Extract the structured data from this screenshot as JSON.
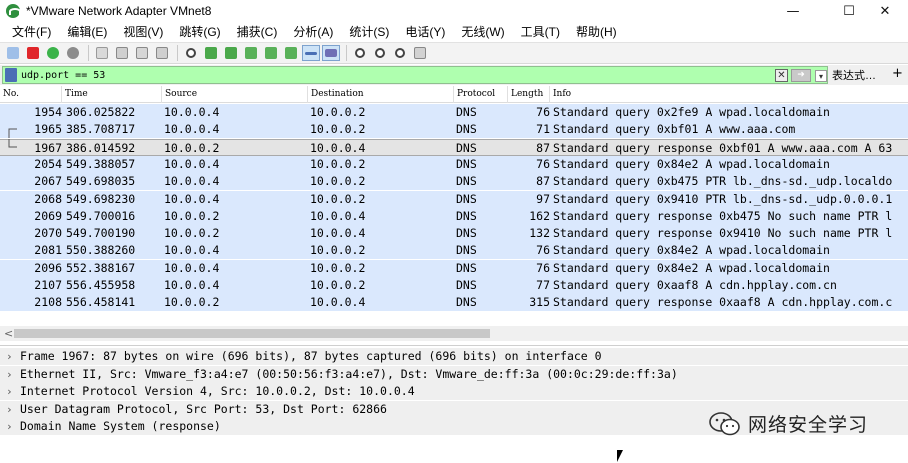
{
  "window": {
    "title": "*VMware Network Adapter VMnet8",
    "minimize": "—",
    "maximize": "☐",
    "close": "✕"
  },
  "menu": [
    "文件(F)",
    "编辑(E)",
    "视图(V)",
    "跳转(G)",
    "捕获(C)",
    "分析(A)",
    "统计(S)",
    "电话(Y)",
    "无线(W)",
    "工具(T)",
    "帮助(H)"
  ],
  "filter": {
    "value": "udp.port == 53",
    "expression_label": "表达式…",
    "add_label": "+"
  },
  "columns": [
    "No.",
    "Time",
    "Source",
    "Destination",
    "Protocol",
    "Length",
    "Info"
  ],
  "packets": [
    {
      "no": "1954",
      "time": "306.025822",
      "src": "10.0.0.4",
      "dst": "10.0.0.2",
      "proto": "DNS",
      "len": "76",
      "info": "Standard query 0x2fe9 A wpad.localdomain"
    },
    {
      "no": "1965",
      "time": "385.708717",
      "src": "10.0.0.4",
      "dst": "10.0.0.2",
      "proto": "DNS",
      "len": "71",
      "info": "Standard query 0xbf01 A www.aaa.com"
    },
    {
      "no": "1967",
      "time": "386.014592",
      "src": "10.0.0.2",
      "dst": "10.0.0.4",
      "proto": "DNS",
      "len": "87",
      "info": "Standard query response 0xbf01 A www.aaa.com A 63"
    },
    {
      "no": "2054",
      "time": "549.388057",
      "src": "10.0.0.4",
      "dst": "10.0.0.2",
      "proto": "DNS",
      "len": "76",
      "info": "Standard query 0x84e2 A wpad.localdomain"
    },
    {
      "no": "2067",
      "time": "549.698035",
      "src": "10.0.0.4",
      "dst": "10.0.0.2",
      "proto": "DNS",
      "len": "87",
      "info": "Standard query 0xb475 PTR lb._dns-sd._udp.localdo"
    },
    {
      "no": "2068",
      "time": "549.698230",
      "src": "10.0.0.4",
      "dst": "10.0.0.2",
      "proto": "DNS",
      "len": "97",
      "info": "Standard query 0x9410 PTR lb._dns-sd._udp.0.0.0.1"
    },
    {
      "no": "2069",
      "time": "549.700016",
      "src": "10.0.0.2",
      "dst": "10.0.0.4",
      "proto": "DNS",
      "len": "162",
      "info": "Standard query response 0xb475 No such name PTR l"
    },
    {
      "no": "2070",
      "time": "549.700190",
      "src": "10.0.0.2",
      "dst": "10.0.0.4",
      "proto": "DNS",
      "len": "132",
      "info": "Standard query response 0x9410 No such name PTR l"
    },
    {
      "no": "2081",
      "time": "550.388260",
      "src": "10.0.0.4",
      "dst": "10.0.0.2",
      "proto": "DNS",
      "len": "76",
      "info": "Standard query 0x84e2 A wpad.localdomain"
    },
    {
      "no": "2096",
      "time": "552.388167",
      "src": "10.0.0.4",
      "dst": "10.0.0.2",
      "proto": "DNS",
      "len": "76",
      "info": "Standard query 0x84e2 A wpad.localdomain"
    },
    {
      "no": "2107",
      "time": "556.455958",
      "src": "10.0.0.4",
      "dst": "10.0.0.2",
      "proto": "DNS",
      "len": "77",
      "info": "Standard query 0xaaf8 A cdn.hpplay.com.cn"
    },
    {
      "no": "2108",
      "time": "556.458141",
      "src": "10.0.0.2",
      "dst": "10.0.0.4",
      "proto": "DNS",
      "len": "315",
      "info": "Standard query response 0xaaf8 A cdn.hpplay.com.c"
    }
  ],
  "selected_packet": "1967",
  "details": [
    "Frame 1967: 87 bytes on wire (696 bits), 87 bytes captured (696 bits) on interface 0",
    "Ethernet II, Src: Vmware_f3:a4:e7 (00:50:56:f3:a4:e7), Dst: Vmware_de:ff:3a (00:0c:29:de:ff:3a)",
    "Internet Protocol Version 4, Src: 10.0.0.2, Dst: 10.0.0.4",
    "User Datagram Protocol, Src Port: 53, Dst Port: 62866",
    "Domain Name System (response)"
  ],
  "watermark": "网络安全学习",
  "colors": {
    "row_bg": "#dae8fd",
    "selected_bg": "#e4e4e4",
    "filter_bg": "#afffaf",
    "details_bg": "#efefef"
  }
}
